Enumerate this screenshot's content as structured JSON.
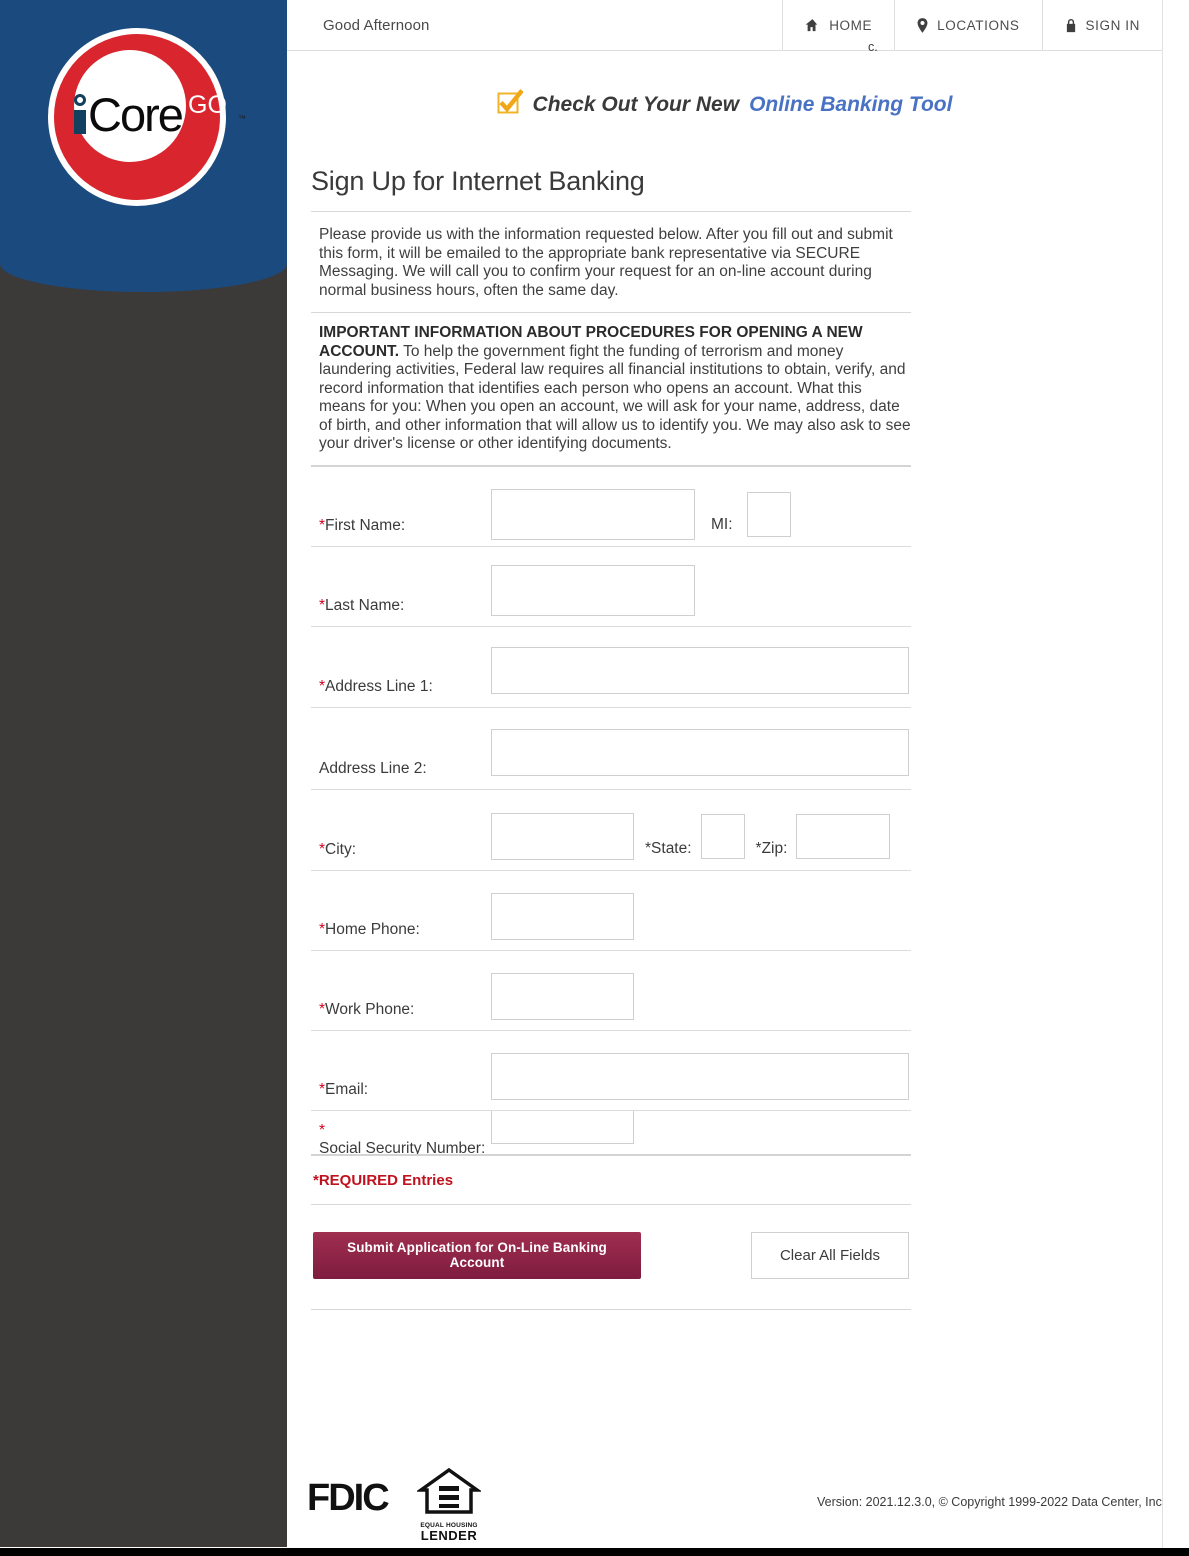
{
  "brand": {
    "logo_core": "Core",
    "logo_go": "GO",
    "logo_tm": "™"
  },
  "topnav": {
    "greeting": "Good Afternoon",
    "items": [
      {
        "label": "HOME",
        "icon": "home-icon"
      },
      {
        "label": "LOCATIONS",
        "icon": "map-pin-icon"
      },
      {
        "label": "SIGN IN",
        "icon": "lock-icon"
      }
    ]
  },
  "promo": {
    "icon": "checkbox-checked-icon",
    "text_plain": "Check Out Your New",
    "text_link": "Online Banking Tool",
    "link_color": "#4a72c4"
  },
  "main": {
    "title": "Sign Up for Internet Banking",
    "intro": "Please provide us with the information requested below.   After you fill out and submit this form, it will be emailed to the appropriate bank representative via SECURE Messaging.  We will call you to confirm your request for an on-line account during normal business hours, often the same day.",
    "kyc_heading": "IMPORTANT INFORMATION ABOUT PROCEDURES FOR OPENING A NEW ACCOUNT.",
    "kyc_body": " To help the government fight the funding of terrorism and money laundering activities, Federal law requires all financial institutions to obtain, verify, and record information that identifies each person who opens an account. What this means for you: When you open an account, we will ask for your name, address, date of birth, and other information that will allow us to identify you. We may also ask to see your driver's license or other identifying documents.",
    "required_note": "*REQUIRED Entries",
    "required_marker": "*"
  },
  "form": {
    "first_name_label": "First Name:",
    "mi_label": "MI:",
    "last_name_label": "Last Name:",
    "address1_label": "Address Line 1:",
    "address2_label": "Address Line 2:",
    "city_label": "City:",
    "state_label": "State:",
    "zip_label": "Zip:",
    "home_phone_label": "Home Phone:",
    "work_phone_label": "Work Phone:",
    "email_label": "Email:",
    "ssn_label": "Social Security Number:",
    "values": {
      "first_name": "",
      "mi": "",
      "last_name": "",
      "address1": "",
      "address2": "",
      "city": "",
      "state": "",
      "zip": "",
      "home_phone": "",
      "work_phone": "",
      "email": "",
      "ssn": ""
    }
  },
  "actions": {
    "submit_label": "Submit Application for On-Line Banking Account",
    "clear_label": "Clear All Fields"
  },
  "footer": {
    "fdic_label": "FDIC",
    "ehl_icon": "equal-housing-lender-icon",
    "ehl_top": "EQUAL HOUSING",
    "ehl_bottom": "LENDER",
    "version": "Version: 2021.12.3.0, © Copyright 1999-2022 Data Center, Inc.",
    "version_clipped": "c."
  },
  "colors": {
    "header_blue": "#1b4a7e",
    "rail_dark": "#3c3a38",
    "logo_red": "#d9262e",
    "required_red": "#d0021b",
    "submit_maroon": "#92274a"
  }
}
